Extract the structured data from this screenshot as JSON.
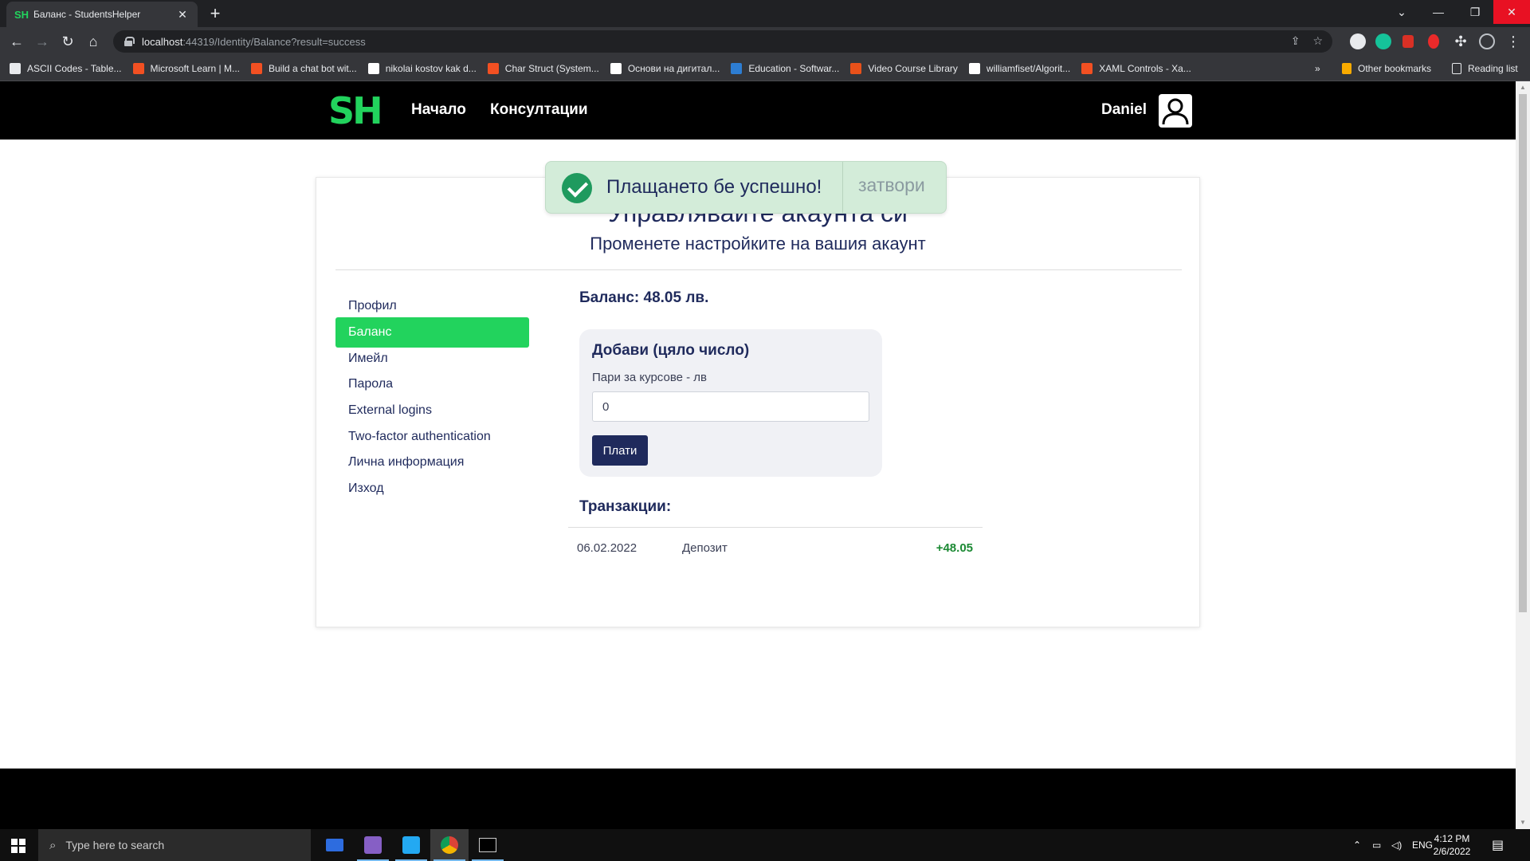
{
  "browser": {
    "tab_title": "Баланс - StudentsHelper",
    "tab_favicon": "SH",
    "url_host": "localhost",
    "url_rest": ":44319/Identity/Balance?result=success",
    "bookmarks": [
      {
        "label": "ASCII Codes - Table...",
        "color": "#e8eaed"
      },
      {
        "label": "Microsoft Learn | M...",
        "color": "#f25022"
      },
      {
        "label": "Build a chat bot wit...",
        "color": "#f25022"
      },
      {
        "label": "nikolai kostov kak d...",
        "color": "#ffffff"
      },
      {
        "label": "Char Struct (System...",
        "color": "#f25022"
      },
      {
        "label": "Основи на дигитал...",
        "color": "#ffffff"
      },
      {
        "label": "Education - Softwar...",
        "color": "#2d7dd2"
      },
      {
        "label": "Video Course Library",
        "color": "#e8511a"
      },
      {
        "label": "williamfiset/Algorit...",
        "color": "#ffffff"
      },
      {
        "label": "XAML Controls - Xa...",
        "color": "#f25022"
      }
    ],
    "more_bookmarks": "»",
    "other_bookmarks": "Other bookmarks",
    "reading_list": "Reading list"
  },
  "site": {
    "logo": "SH",
    "nav": {
      "home": "Начало",
      "consultations": "Консултации",
      "user": "Daniel"
    }
  },
  "card": {
    "title": "Управлявайте акаунта си",
    "subtitle": "Променете настройките на вашия акаунт"
  },
  "sidebar": {
    "items": [
      {
        "label": "Профил",
        "active": false
      },
      {
        "label": "Баланс",
        "active": true
      },
      {
        "label": "Имейл",
        "active": false
      },
      {
        "label": "Парола",
        "active": false
      },
      {
        "label": "External logins",
        "active": false
      },
      {
        "label": "Two-factor authentication",
        "active": false
      },
      {
        "label": "Лична информация",
        "active": false
      },
      {
        "label": "Изход",
        "active": false
      }
    ]
  },
  "balance": {
    "title": "Баланс: 48.05 лв.",
    "add_title": "Добави (цяло число)",
    "add_label": "Пари за курсове - лв",
    "input_value": "0",
    "pay_button": "Плати"
  },
  "transactions": {
    "title": "Транзакции:",
    "rows": [
      {
        "date": "06.02.2022",
        "type": "Депозит",
        "amount": "+48.05"
      }
    ]
  },
  "toast": {
    "message": "Плащането бе успешно!",
    "close": "затвори"
  },
  "taskbar": {
    "search_placeholder": "Type here to search",
    "language": "ENG",
    "time": "4:12 PM",
    "date": "2/6/2022"
  },
  "colors": {
    "brand_green": "#22d35d",
    "navy": "#1f2a5c",
    "toast_bg": "#d3ecd9",
    "amount_green": "#1c8a34"
  }
}
